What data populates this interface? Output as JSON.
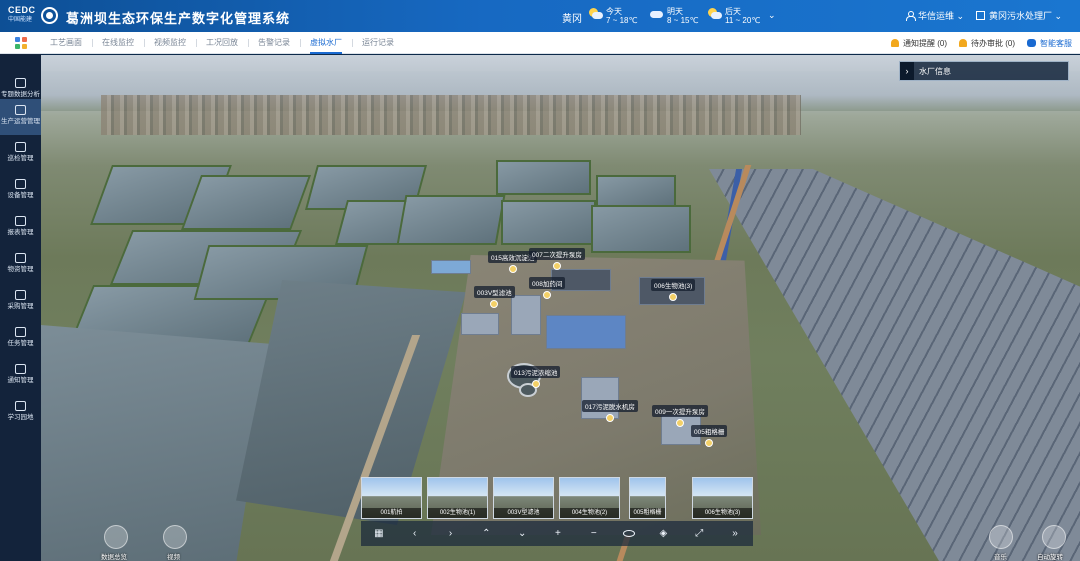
{
  "header": {
    "logo_text": "CEDC",
    "logo_sub": "中国能建",
    "title": "葛洲坝生态环保生产数字化管理系统",
    "city": "黄冈",
    "weather": [
      {
        "day": "今天",
        "temp": "7 ~ 18℃",
        "icon": "sun-cloud-icon"
      },
      {
        "day": "明天",
        "temp": "8 ~ 15℃",
        "icon": "cloud-icon"
      },
      {
        "day": "后天",
        "temp": "11 ~ 20℃",
        "icon": "sun-cloud-icon"
      }
    ],
    "user": "华信运维",
    "plant": "黄冈污水处理厂"
  },
  "nav": {
    "tabs": [
      "工艺画面",
      "在线监控",
      "视频监控",
      "工况回放",
      "告警记录",
      "虚拟水厂",
      "运行记录"
    ],
    "active_tab": "虚拟水厂",
    "notice": "通知提醒 (0)",
    "todo": "待办审批 (0)",
    "assistant": "智能客服"
  },
  "sidebar": {
    "items": [
      {
        "label": "专题数据分析",
        "icon": "chart-icon"
      },
      {
        "label": "生产运营管理",
        "icon": "production-icon"
      },
      {
        "label": "巡检管理",
        "icon": "inspection-icon"
      },
      {
        "label": "设备管理",
        "icon": "equipment-icon"
      },
      {
        "label": "报表管理",
        "icon": "report-icon"
      },
      {
        "label": "物资管理",
        "icon": "materials-icon"
      },
      {
        "label": "采购管理",
        "icon": "purchase-icon"
      },
      {
        "label": "任务管理",
        "icon": "task-icon"
      },
      {
        "label": "通知管理",
        "icon": "notice-icon"
      },
      {
        "label": "学习园地",
        "icon": "book-icon"
      }
    ],
    "active_index": 1
  },
  "scene": {
    "info_panel": "水厂信息",
    "markers": [
      "015高效沉淀池",
      "007二次提升泵房",
      "003V型滤池",
      "008加药间",
      "006生物池(3)",
      "013污泥浓缩池",
      "017污泥脱水机房",
      "009一次提升泵房",
      "005粗格栅"
    ],
    "thumbnails": [
      "001航拍",
      "002生物池(1)",
      "003V型滤池",
      "004生物池(2)",
      "005粗格栅",
      "006生物池(3)"
    ],
    "left_buttons": [
      "数据总览",
      "视频"
    ],
    "right_buttons": [
      "音乐",
      "自动旋转"
    ]
  }
}
